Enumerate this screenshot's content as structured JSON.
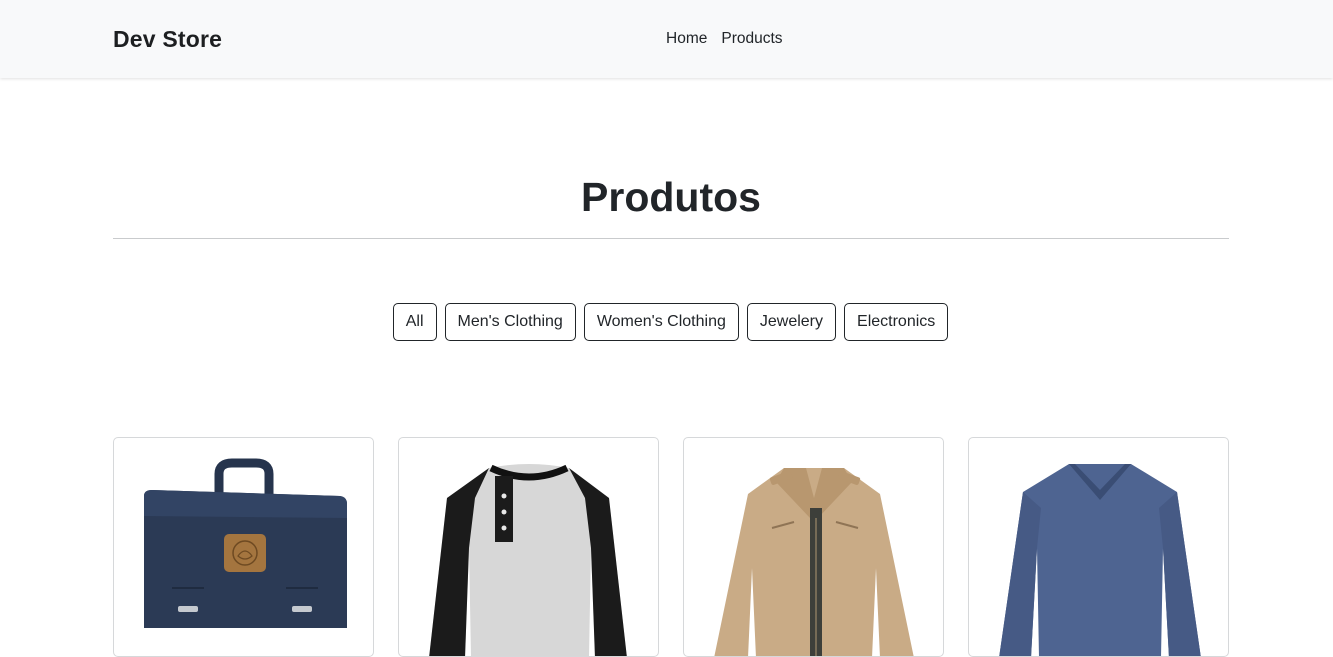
{
  "navbar": {
    "brand": "Dev Store",
    "links": [
      {
        "label": "Home"
      },
      {
        "label": "Products"
      }
    ]
  },
  "page": {
    "title": "Produtos"
  },
  "filters": {
    "buttons": [
      {
        "label": "All"
      },
      {
        "label": "Men's Clothing"
      },
      {
        "label": "Women's Clothing"
      },
      {
        "label": "Jewelery"
      },
      {
        "label": "Electronics"
      }
    ]
  },
  "products": [
    {
      "image": "backpack",
      "color": "#2b3a55"
    },
    {
      "image": "raglan-henley-shirt",
      "color": "#d4d4d4"
    },
    {
      "image": "cotton-jacket",
      "color": "#c9ab86"
    },
    {
      "image": "v-neck-long-sleeve-shirt",
      "color": "#4e6491"
    }
  ]
}
